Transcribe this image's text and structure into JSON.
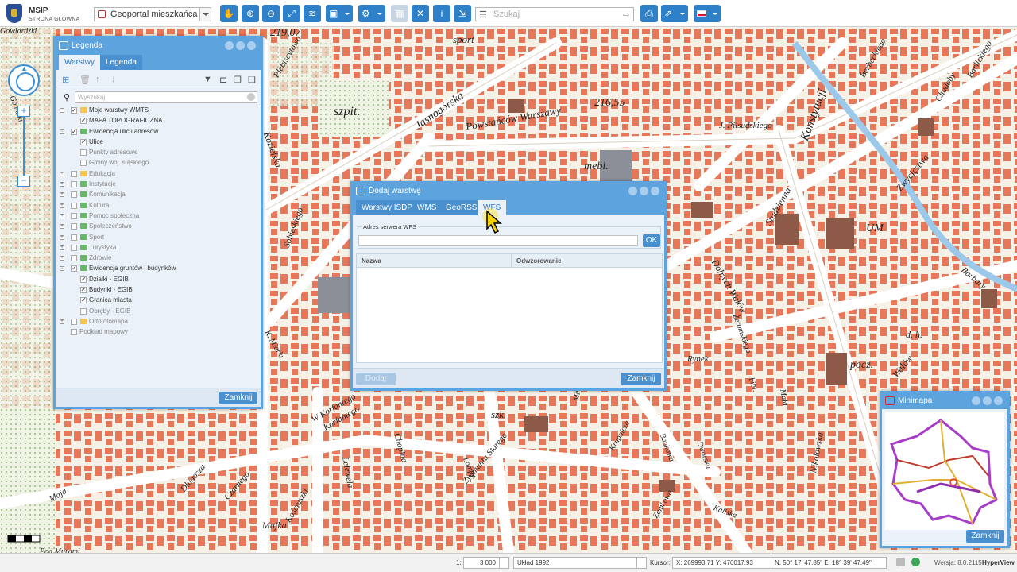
{
  "app": {
    "name": "MSIP",
    "subtitle": "STRONA GŁÓWNA"
  },
  "toolbar": {
    "portal_select": "Geoportal mieszkańca",
    "search_placeholder": "Szukaj",
    "icons": [
      "hand-icon",
      "zoom-in-icon",
      "zoom-out-icon",
      "full-extent-icon",
      "layers-icon",
      "add-icon",
      "tools-icon",
      "grid-icon",
      "measure-icon",
      "info-icon",
      "menu-icon",
      "print-icon",
      "share-icon",
      "flag-icon"
    ]
  },
  "map_labels": [
    "219,07",
    "216,55",
    "sport",
    "szpit.",
    "Jasnogórska",
    "Powstańców Warszawy",
    "J. Piłsudskiego",
    "Konstytucji",
    "mebl.",
    "UM",
    "Rynek",
    "pocz.",
    "szk.",
    "Kozielska",
    "Sobieskiego",
    "Dolnych Wałów",
    "Studzienna",
    "Zwycięstwa",
    "Chudoby",
    "Barlickiego",
    "Berbeckiego",
    "Barbary",
    "Kościuszki",
    "Długosza",
    "Czarnego",
    "Zygmunta Starego",
    "Lelewela",
    "Chopina",
    "Korfantego",
    "Krupnicza",
    "Bankowa",
    "Dworska",
    "Nikolowska",
    "Zamkowa",
    "Majka",
    "bibl.",
    "Mikulicza",
    "Wałów",
    "Maja",
    "Sobieskiego",
    "Gomółki",
    "Plebiscytowa",
    "Mała",
    "d. h.",
    "W Korfantego",
    "Lompy",
    "Żeromskiego",
    "K. Miarki",
    "Kaliska",
    "Pod Murami",
    "Gowlardzki"
  ],
  "legend": {
    "title": "Legenda",
    "tabs": [
      "Warstwy",
      "Legenda"
    ],
    "search_placeholder": "Wyszukaj",
    "close": "Zamknij",
    "tree": [
      {
        "level": 0,
        "label": "Moje warstwy WMTS",
        "checked": true,
        "folder": true,
        "expanded": true,
        "color": "#f0c550"
      },
      {
        "level": 1,
        "label": "MAPA TOPOGRAFICZNA",
        "checked": true
      },
      {
        "level": 0,
        "label": "Ewidencja ulic i adresów",
        "checked": true,
        "folder": true,
        "expanded": true,
        "color": "#69b86a"
      },
      {
        "level": 1,
        "label": "Ulice",
        "checked": true
      },
      {
        "level": 1,
        "label": "Punkty adresowe",
        "checked": false
      },
      {
        "level": 1,
        "label": "Gminy woj. śląskiego",
        "checked": false
      },
      {
        "level": 0,
        "label": "Edukacja",
        "checked": false,
        "folder": true,
        "color": "#f0c550"
      },
      {
        "level": 0,
        "label": "Instytucje",
        "checked": false,
        "folder": true,
        "color": "#69b86a"
      },
      {
        "level": 0,
        "label": "Komunikacja",
        "checked": false,
        "folder": true,
        "color": "#69b86a"
      },
      {
        "level": 0,
        "label": "Kultura",
        "checked": false,
        "folder": true,
        "color": "#69b86a"
      },
      {
        "level": 0,
        "label": "Pomoc społeczna",
        "checked": false,
        "folder": true,
        "color": "#69b86a"
      },
      {
        "level": 0,
        "label": "Społeczeństwo",
        "checked": false,
        "folder": true,
        "color": "#69b86a"
      },
      {
        "level": 0,
        "label": "Sport",
        "checked": false,
        "folder": true,
        "color": "#69b86a"
      },
      {
        "level": 0,
        "label": "Turystyka",
        "checked": false,
        "folder": true,
        "color": "#69b86a"
      },
      {
        "level": 0,
        "label": "Zdrowie",
        "checked": false,
        "folder": true,
        "color": "#69b86a"
      },
      {
        "level": 0,
        "label": "Ewidencja gruntów i budynków",
        "checked": true,
        "folder": true,
        "expanded": true,
        "color": "#69b86a"
      },
      {
        "level": 1,
        "label": "Działki - EGIB",
        "checked": true
      },
      {
        "level": 1,
        "label": "Budynki - EGIB",
        "checked": true
      },
      {
        "level": 1,
        "label": "Granica miasta",
        "checked": true
      },
      {
        "level": 1,
        "label": "Obręby - EGIB",
        "checked": false
      },
      {
        "level": 0,
        "label": "Ortofotomapa",
        "checked": false,
        "folder": true,
        "color": "#f0c550"
      },
      {
        "level": 0,
        "label": "Podkład mapowy",
        "checked": false,
        "folder": false
      }
    ]
  },
  "dialog": {
    "title": "Dodaj warstwę",
    "tabs": [
      "Warstwy ISDP",
      "WMS",
      "GeoRSS",
      "WFS"
    ],
    "active_tab": "WFS",
    "group_label": "Adres serwera WFS",
    "server_value": "",
    "ok": "OK",
    "columns": [
      "Nazwa",
      "Odwzorowanie"
    ],
    "add": "Dodaj",
    "close": "Zamknij"
  },
  "minimap": {
    "title": "Minimapa",
    "close": "Zamknij"
  },
  "status": {
    "scale_prefix": "1:",
    "scale": "3 000",
    "crs": "Układ 1992",
    "cursor_label": "Kursor:",
    "x": "X: 269993.71",
    "y": "Y: 476017.93",
    "geo": "N: 50° 17' 47.85\" E: 18° 39' 47.49\"",
    "version": "Wersja: 8.0.2115",
    "vendor": "HyperView"
  },
  "colors": {
    "accent": "#5da3dd",
    "building": "#e8775a",
    "street": "#ffffff",
    "park": "#b9dca0",
    "map_bg": "#f3efe6"
  }
}
